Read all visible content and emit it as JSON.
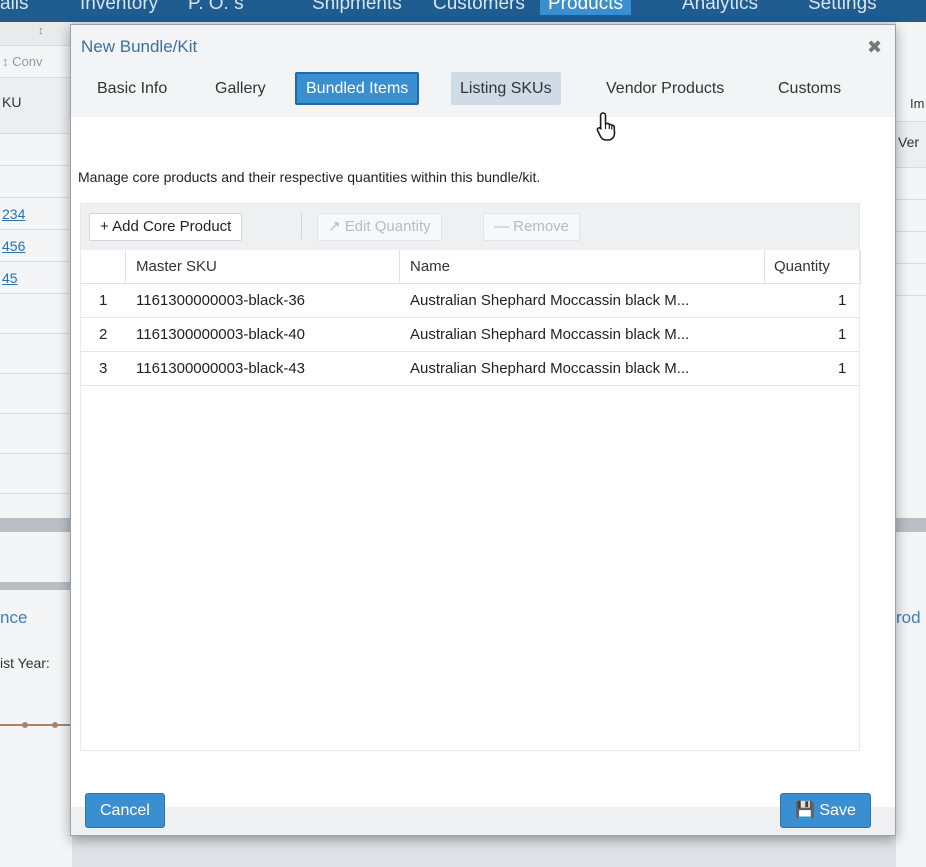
{
  "topnav": {
    "items": [
      "ails",
      "Inventory",
      "P. O. s",
      "Shipments",
      "Customers",
      "Products",
      "Analytics",
      "Settings"
    ],
    "active_index": 5
  },
  "background": {
    "left_texts": [
      "↕",
      "↕ Conv",
      "KU",
      "234",
      "456",
      "45",
      "nce",
      "ist Year:"
    ],
    "right_texts": [
      "Im",
      "Ver",
      "rod"
    ]
  },
  "modal": {
    "title": "New Bundle/Kit",
    "close_glyph": "✖",
    "tabs": [
      {
        "label": "Basic Info"
      },
      {
        "label": "Gallery"
      },
      {
        "label": "Bundled Items"
      },
      {
        "label": "Listing SKUs"
      },
      {
        "label": "Vendor Products"
      },
      {
        "label": "Customs"
      }
    ],
    "active_tab": "Bundled Items",
    "hover_tab": "Listing SKUs",
    "description": "Manage core products and their respective quantities within this bundle/kit.",
    "toolbar": {
      "add_label": "+ Add Core Product",
      "edit_label": "↗ Edit Quantity",
      "remove_label": "— Remove"
    },
    "columns": [
      "Master SKU",
      "Name",
      "Quantity"
    ],
    "rows": [
      {
        "num": "1",
        "sku": "1161300000003-black-36",
        "name": "Australian Shephard Moccassin black M...",
        "qty": "1"
      },
      {
        "num": "2",
        "sku": "1161300000003-black-40",
        "name": "Australian Shephard Moccassin black M...",
        "qty": "1"
      },
      {
        "num": "3",
        "sku": "1161300000003-black-43",
        "name": "Australian Shephard Moccassin black M...",
        "qty": "1"
      }
    ],
    "footer": {
      "cancel_label": "Cancel",
      "save_label": "💾 Save"
    }
  },
  "colors": {
    "accent": "#3a8fd0",
    "nav_bg": "#1f5c8f",
    "title_color": "#3f6f9f"
  },
  "icons": {
    "close": "close-icon",
    "add": "plus-icon",
    "edit": "edit-icon",
    "remove": "minus-icon",
    "save": "floppy-disk-icon",
    "cursor": "hand-pointer-icon"
  }
}
